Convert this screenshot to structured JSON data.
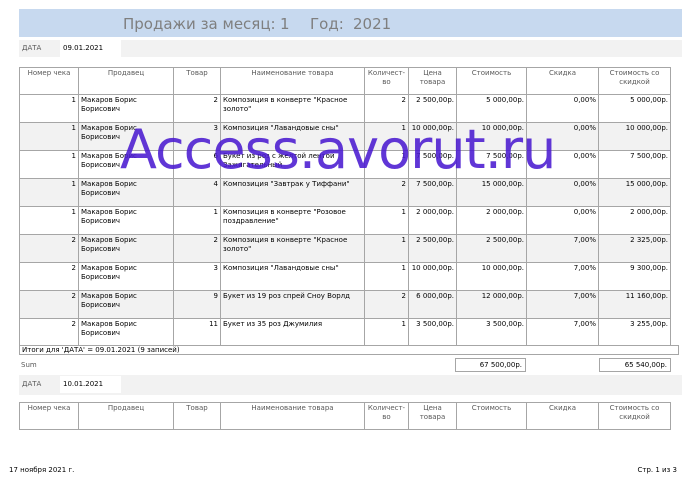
{
  "report": {
    "title_label": "Продажи за месяц:",
    "month": "1",
    "year_label": "Год:",
    "year": "2021"
  },
  "group1": {
    "date_label": "ДАТА",
    "date_value": "09.01.2021"
  },
  "columns": [
    "Номер чека",
    "Продавец",
    "Товар",
    "Наименование товара",
    "Количест-во",
    "Цена товара",
    "Стоимость",
    "Скидка",
    "Стоимость со скидкой"
  ],
  "rows": [
    {
      "check": "1",
      "seller": "Макаров Борис Борисович",
      "item": "2",
      "name": "Композиция в конверте \"Красное золото\"",
      "qty": "2",
      "price": "2 500,00р.",
      "cost": "5 000,00р.",
      "discount": "0,00%",
      "total": "5 000,00р."
    },
    {
      "check": "1",
      "seller": "Макаров Борис Борисович",
      "item": "3",
      "name": "Композиция \"Лавандовые сны\"",
      "qty": "1",
      "price": "10 000,00р.",
      "cost": "10 000,00р.",
      "discount": "0,00%",
      "total": "10 000,00р."
    },
    {
      "check": "1",
      "seller": "Макаров Борис Борисович",
      "item": "6",
      "name": "Букет из роз с желтой лентой Зажигательный",
      "qty": "1",
      "price": "7 500,00р.",
      "cost": "7 500,00р.",
      "discount": "0,00%",
      "total": "7 500,00р."
    },
    {
      "check": "1",
      "seller": "Макаров Борис Борисович",
      "item": "4",
      "name": "Композиция \"Завтрак у Тиффани\"",
      "qty": "2",
      "price": "7 500,00р.",
      "cost": "15 000,00р.",
      "discount": "0,00%",
      "total": "15 000,00р."
    },
    {
      "check": "1",
      "seller": "Макаров Борис Борисович",
      "item": "1",
      "name": "Композиция в конверте \"Розовое поздравление\"",
      "qty": "1",
      "price": "2 000,00р.",
      "cost": "2 000,00р.",
      "discount": "0,00%",
      "total": "2 000,00р."
    },
    {
      "check": "2",
      "seller": "Макаров Борис Борисович",
      "item": "2",
      "name": "Композиция в конверте \"Красное золото\"",
      "qty": "1",
      "price": "2 500,00р.",
      "cost": "2 500,00р.",
      "discount": "7,00%",
      "total": "2 325,00р."
    },
    {
      "check": "2",
      "seller": "Макаров Борис Борисович",
      "item": "3",
      "name": "Композиция \"Лавандовые сны\"",
      "qty": "1",
      "price": "10 000,00р.",
      "cost": "10 000,00р.",
      "discount": "7,00%",
      "total": "9 300,00р."
    },
    {
      "check": "2",
      "seller": "Макаров Борис Борисович",
      "item": "9",
      "name": "Букет из 19 роз спрей Сноу Ворлд",
      "qty": "2",
      "price": "6 000,00р.",
      "cost": "12 000,00р.",
      "discount": "7,00%",
      "total": "11 160,00р."
    },
    {
      "check": "2",
      "seller": "Макаров Борис Борисович",
      "item": "11",
      "name": "Букет из 35 роз Джумилия",
      "qty": "1",
      "price": "3 500,00р.",
      "cost": "3 500,00р.",
      "discount": "7,00%",
      "total": "3 255,00р."
    }
  ],
  "group1_totals": {
    "summary_text": "Итоги для 'ДАТА' = 09.01.2021 (9 записей)",
    "sum_label": "Sum",
    "sum_cost": "67 500,00р.",
    "sum_total": "65 540,00р."
  },
  "group2": {
    "date_label": "ДАТА",
    "date_value": "10.01.2021"
  },
  "footer": {
    "printed_date": "17 ноября 2021 г.",
    "page_info": "Стр. 1 из 3"
  },
  "watermark": "Access.avorut.ru"
}
